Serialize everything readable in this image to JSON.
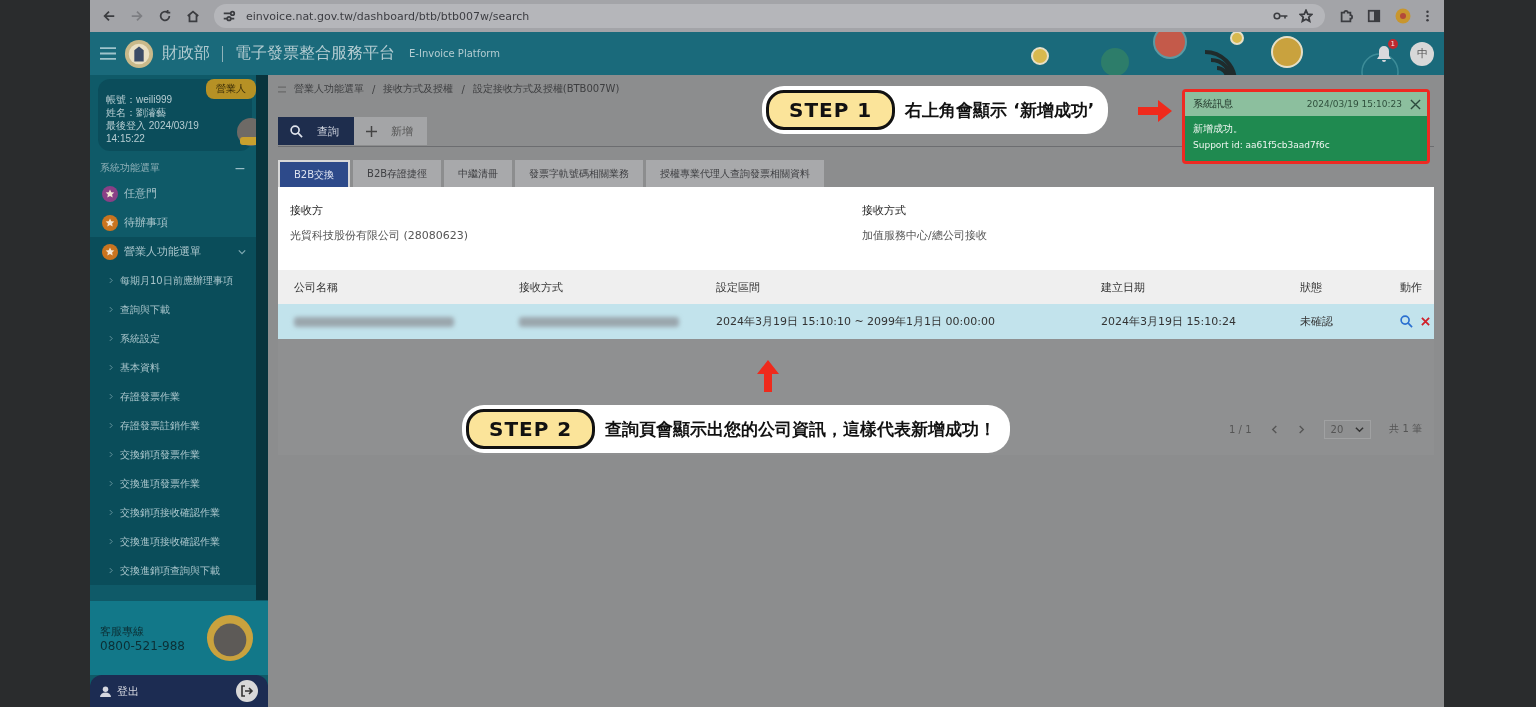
{
  "browser": {
    "url": "einvoice.nat.gov.tw/dashboard/btb/btb007w/search"
  },
  "header": {
    "org": "財政部",
    "platform": "電子發票整合服務平台",
    "subtitle": "E-Invoice Platform",
    "notification_count": "1",
    "language": "中"
  },
  "sidebar": {
    "role_badge": "營業人",
    "account": "帳號：weili999",
    "name": "姓名：劉濬藝",
    "last_login": "最後登入 2024/03/19 14:15:22",
    "menu_title": "系統功能選單",
    "menu_toggle": "−",
    "items": [
      {
        "label": "任意門",
        "color": "#8a3f86",
        "expanded": false
      },
      {
        "label": "待辦事項",
        "color": "#c9741f",
        "expanded": false
      },
      {
        "label": "營業人功能選單",
        "color": "#c9741f",
        "expanded": true,
        "children": [
          {
            "label": "每期月10日前應辦理事項"
          },
          {
            "label": "查詢與下載"
          },
          {
            "label": "系統設定"
          },
          {
            "label": "基本資料"
          },
          {
            "label": "存證發票作業"
          },
          {
            "label": "存證發票註銷作業"
          },
          {
            "label": "交換銷項發票作業"
          },
          {
            "label": "交換進項發票作業"
          },
          {
            "label": "交換銷項接收確認作業"
          },
          {
            "label": "交換進項接收確認作業"
          },
          {
            "label": "交換進銷項查詢與下載"
          }
        ]
      }
    ],
    "hotline_label": "客服專線",
    "hotline": "0800-521-988",
    "logout": "登出"
  },
  "main": {
    "breadcrumb": [
      "營業人功能選單",
      "/",
      "接收方式及授權",
      "/",
      "設定接收方式及授權(BTB007W)"
    ],
    "actions": [
      {
        "label": "查詢",
        "kind": "search",
        "selected": true
      },
      {
        "label": "新增",
        "kind": "add",
        "selected": false
      }
    ],
    "tabs": [
      {
        "label": "B2B交換",
        "selected": true
      },
      {
        "label": "B2B存證捷徑",
        "selected": false
      },
      {
        "label": "中繼清冊",
        "selected": false
      },
      {
        "label": "發票字軌號碼相關業務",
        "selected": false
      },
      {
        "label": "授權專業代理人查詢發票相關資料",
        "selected": false
      }
    ],
    "info": [
      {
        "label": "接收方",
        "value": "光貿科技股份有限公司 (28080623)"
      },
      {
        "label": "接收方式",
        "value": "加值服務中心/總公司接收"
      }
    ],
    "table": {
      "columns": [
        "公司名稱",
        "接收方式",
        "設定區間",
        "建立日期",
        "狀態",
        "動作"
      ],
      "rows": [
        {
          "selected": true,
          "cells": [
            {
              "redacted": true
            },
            {
              "redacted": true
            },
            {
              "text": "2024年3月19日 15:10:10 ~ 2099年1月1日 00:00:00"
            },
            {
              "text": "2024年3月19日 15:10:24"
            },
            {
              "text": "未確認"
            },
            {
              "kind": "actions"
            }
          ]
        }
      ]
    },
    "pagination": {
      "page": "1 / 1",
      "page_size": "20",
      "total": "共 1 筆"
    }
  },
  "toast": {
    "title": "系統訊息",
    "time": "2024/03/19 15:10:23",
    "message": "新增成功。",
    "support": "Support id: aa61f5cb3aad7f6c"
  },
  "annotations": [
    {
      "step": "STEP 1",
      "text": "右上角會顯示 ‘新增成功’",
      "kind": "toast"
    },
    {
      "step": "STEP 2",
      "text": "查詢頁會顯示出您的公司資訊，這樣代表新增成功！",
      "kind": "row"
    }
  ]
}
